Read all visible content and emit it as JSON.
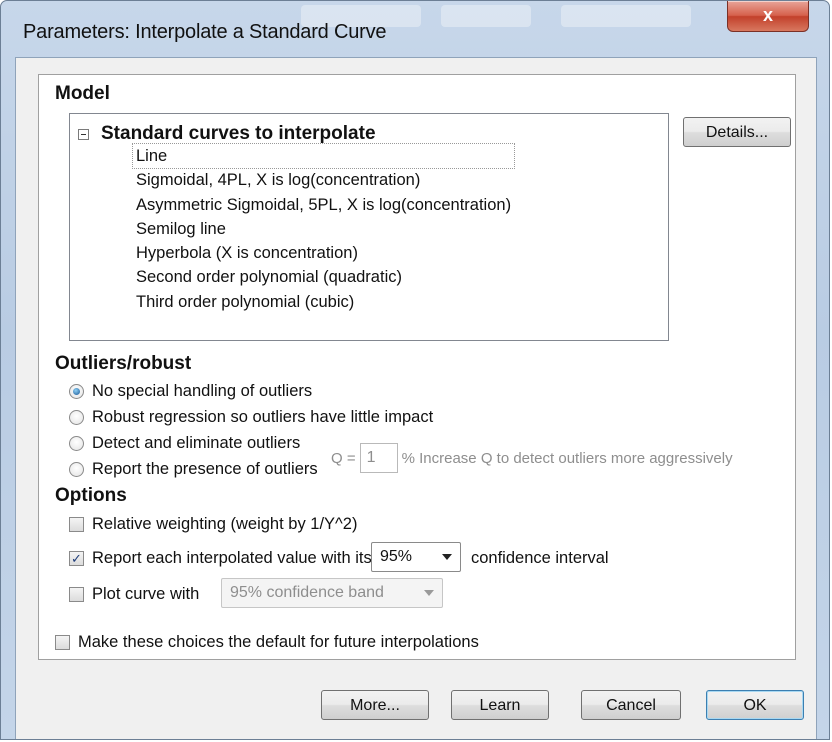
{
  "window": {
    "title": "Parameters: Interpolate a Standard Curve",
    "close_label": "x"
  },
  "model": {
    "label": "Model",
    "tree_title": "Standard curves to interpolate",
    "items": [
      "Line",
      "Sigmoidal, 4PL, X is log(concentration)",
      "Asymmetric Sigmoidal, 5PL, X is log(concentration)",
      "Semilog line",
      "Hyperbola (X is concentration)",
      "Second order polynomial (quadratic)",
      "Third order polynomial  (cubic)"
    ],
    "selected_item": "Line",
    "details_label": "Details..."
  },
  "outliers": {
    "label": "Outliers/robust",
    "options": [
      "No special handling of outliers",
      "Robust regression so outliers have little impact",
      "Detect and eliminate outliers",
      "Report the presence of outliers"
    ],
    "selected_index": 0,
    "q_label": "Q =",
    "q_value": "1",
    "q_hint": "% Increase Q to detect outliers more aggressively"
  },
  "options": {
    "label": "Options",
    "relative_weighting": {
      "label": "Relative weighting (weight by 1/Y^2)",
      "checked": false
    },
    "report_interpolated": {
      "label": "Report each interpolated value with its",
      "checked": true,
      "select_value": "95%",
      "suffix": "confidence interval"
    },
    "plot_curve": {
      "label": "Plot curve with",
      "checked": false,
      "select_value": "95% confidence band"
    }
  },
  "default_choice": {
    "label": "Make these choices the default for future interpolations",
    "checked": false
  },
  "buttons": {
    "more": "More...",
    "learn": "Learn",
    "cancel": "Cancel",
    "ok": "OK"
  },
  "colors": {
    "accent": "#3c7fb1",
    "close_button": "#c2402b",
    "window_frame": "#b9cce3"
  }
}
